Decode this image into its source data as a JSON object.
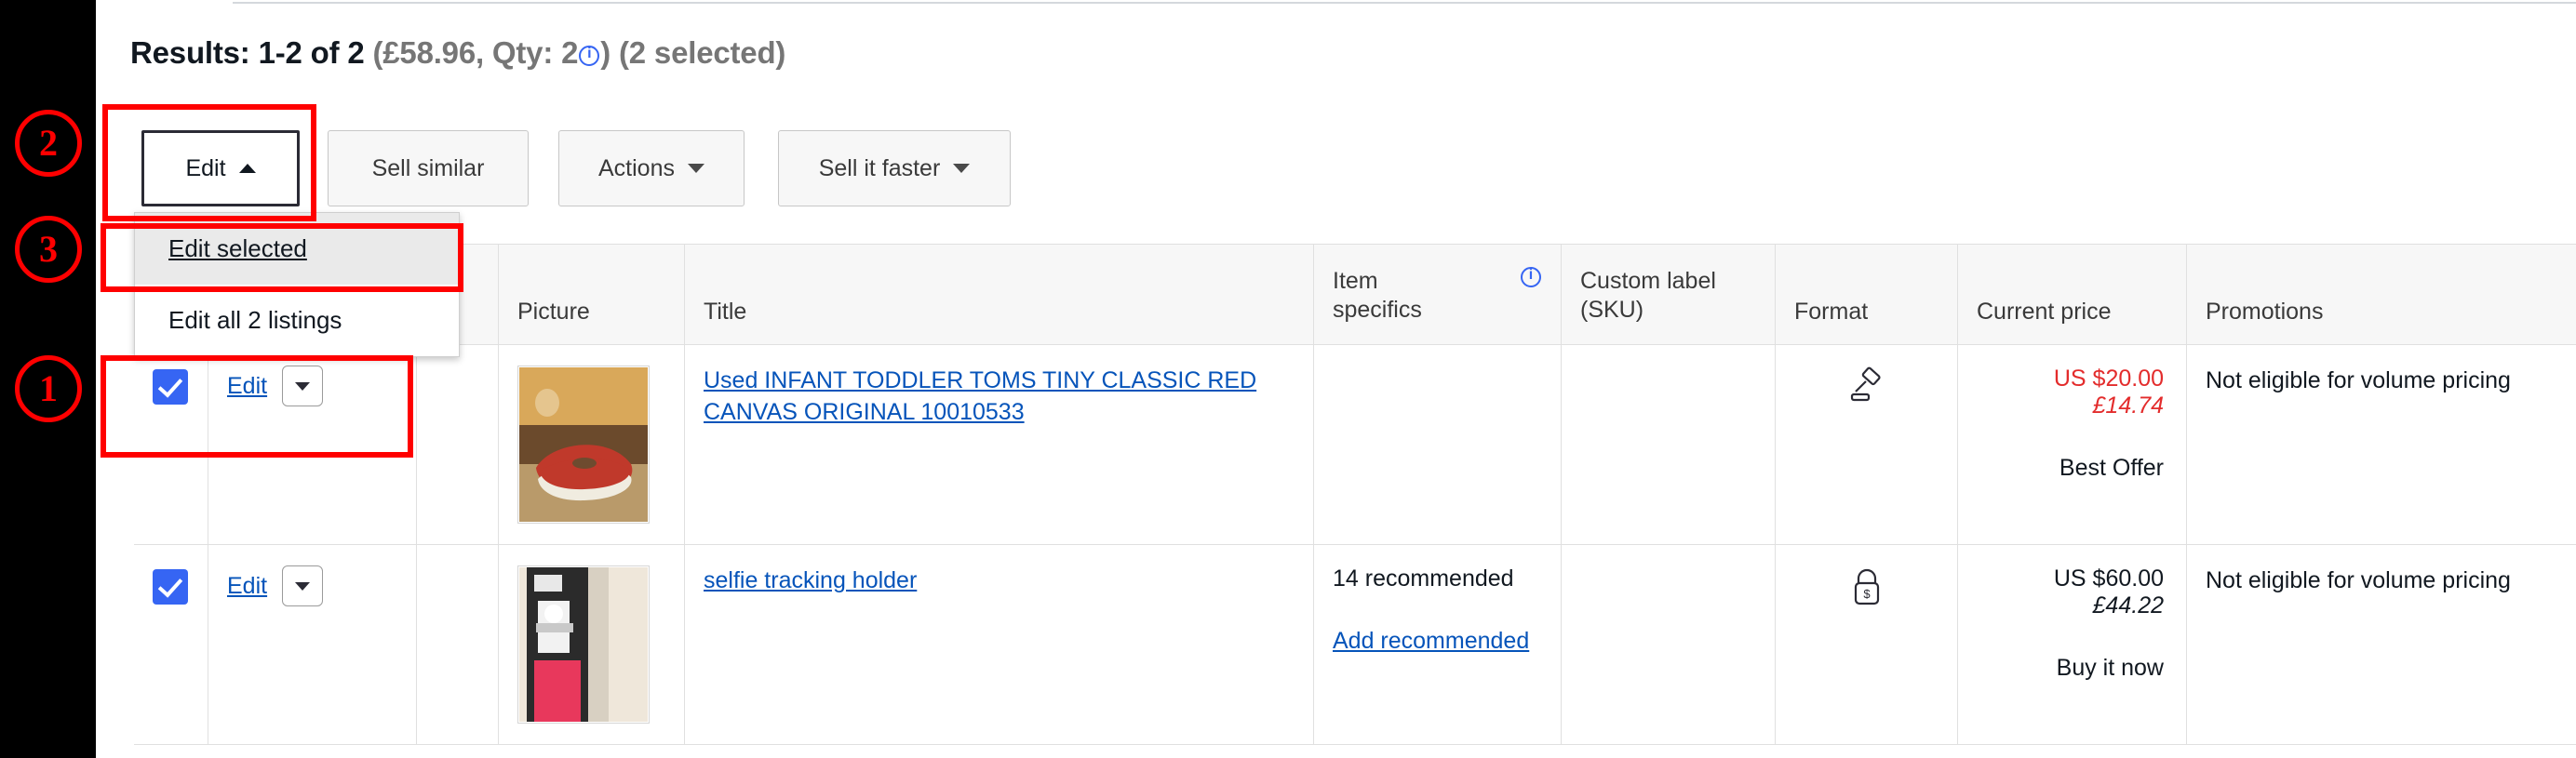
{
  "header": {
    "results_prefix": "Results: 1-2 of 2",
    "results_detail_open": " (£58.96, Qty: 2",
    "results_detail_close": ") (2 selected)",
    "info_icon": "info-icon"
  },
  "toolbar": {
    "edit_label": "Edit",
    "sell_similar_label": "Sell similar",
    "actions_label": "Actions",
    "sell_it_faster_label": "Sell it faster"
  },
  "edit_menu": {
    "items": [
      {
        "label": "Edit selected",
        "highlighted": true
      },
      {
        "label": "Edit all 2 listings",
        "highlighted": false
      }
    ]
  },
  "table": {
    "columns": [
      {
        "key": "checkbox",
        "label": ""
      },
      {
        "key": "edit",
        "label": ""
      },
      {
        "key": "gap",
        "label": ""
      },
      {
        "key": "picture",
        "label": "Picture"
      },
      {
        "key": "title",
        "label": "Title"
      },
      {
        "key": "item_specifics",
        "label": "Item specifics",
        "info_icon": "info-icon"
      },
      {
        "key": "custom_label",
        "label": "Custom label (SKU)"
      },
      {
        "key": "format",
        "label": "Format"
      },
      {
        "key": "current_price",
        "label": "Current price"
      },
      {
        "key": "promotions",
        "label": "Promotions"
      }
    ],
    "rows": [
      {
        "selected": true,
        "edit_label": "Edit",
        "row_caret": "chevron-down-icon",
        "thumbnail": "shoe-thumbnail",
        "title": "Used INFANT TODDLER TOMS TINY CLASSIC RED CANVAS ORIGINAL 10010533",
        "item_specifics": "",
        "item_specifics_link": "",
        "custom_label": "",
        "format_icon": "auction-gavel-icon",
        "price_main": "US $20.00",
        "price_converted": "£14.74",
        "price_type": "Best Offer",
        "price_is_red": true,
        "promotions": "Not eligible for volume pricing"
      },
      {
        "selected": true,
        "edit_label": "Edit",
        "row_caret": "chevron-down-icon",
        "thumbnail": "selfie-holder-thumbnail",
        "title": "selfie tracking holder",
        "item_specifics": "14 recommended",
        "item_specifics_link": "Add recommended",
        "custom_label": "",
        "format_icon": "buy-it-now-lock-icon",
        "price_main": "US $60.00",
        "price_converted": "£44.22",
        "price_type": "Buy it now",
        "price_is_red": false,
        "promotions": "Not eligible for volume pricing"
      }
    ]
  },
  "annotations": [
    {
      "number": "1"
    },
    {
      "number": "2"
    },
    {
      "number": "3"
    }
  ],
  "colors": {
    "accent_blue": "#3665f3",
    "link_blue": "#0654ba",
    "price_red": "#e32c2c",
    "annotation_red": "#ff0000",
    "muted_text": "#767676"
  }
}
